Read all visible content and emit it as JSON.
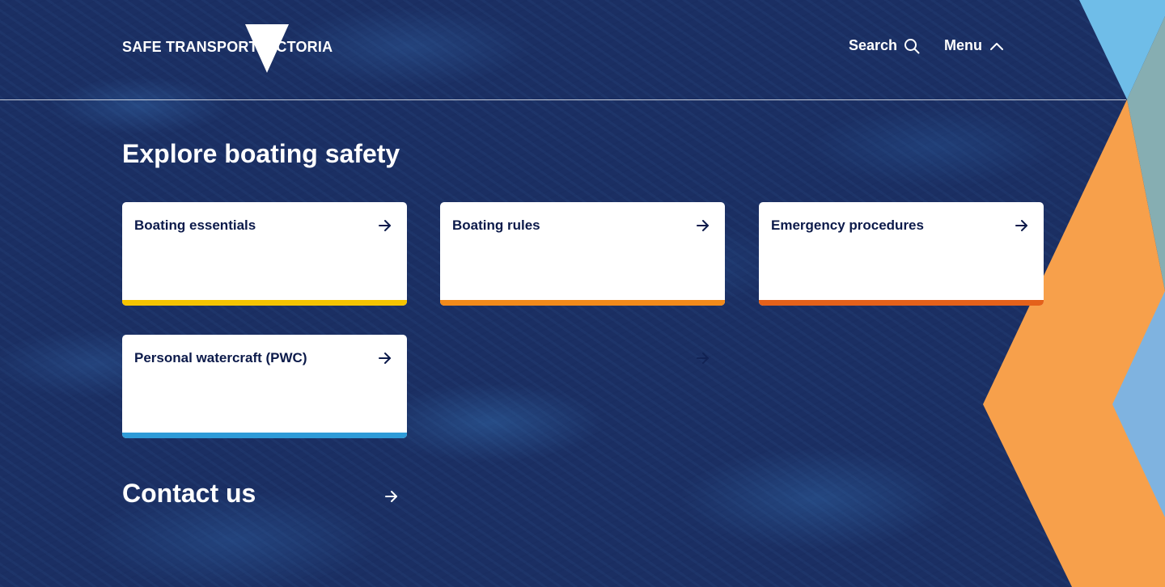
{
  "brand": {
    "logo_text": "SAFE TRANSPORT VICTORIA"
  },
  "header": {
    "search_label": "Search",
    "menu_label": "Menu"
  },
  "main": {
    "title": "Explore boating safety",
    "cards": [
      {
        "label": "Boating essentials",
        "accent": "#f5c400"
      },
      {
        "label": "Boating rules",
        "accent": "#f28a1a"
      },
      {
        "label": "Emergency procedures",
        "accent": "#e4611a"
      },
      {
        "label": "Personal watercraft (PWC)",
        "accent": "#2e9bd8"
      }
    ],
    "contact_label": "Contact us"
  },
  "colors": {
    "background": "#1b2f63",
    "card_text": "#0c1a4a",
    "deco_orange": "#f7a04b",
    "deco_light_blue": "#6fbde8",
    "deco_grey_teal": "#86aeb2",
    "deco_mid_blue": "#7fb3e0"
  },
  "icons": {
    "search": "search-icon",
    "menu": "chevron-up-icon",
    "card_arrow": "arrow-right-icon",
    "logo": "victoria-triangle-icon"
  }
}
